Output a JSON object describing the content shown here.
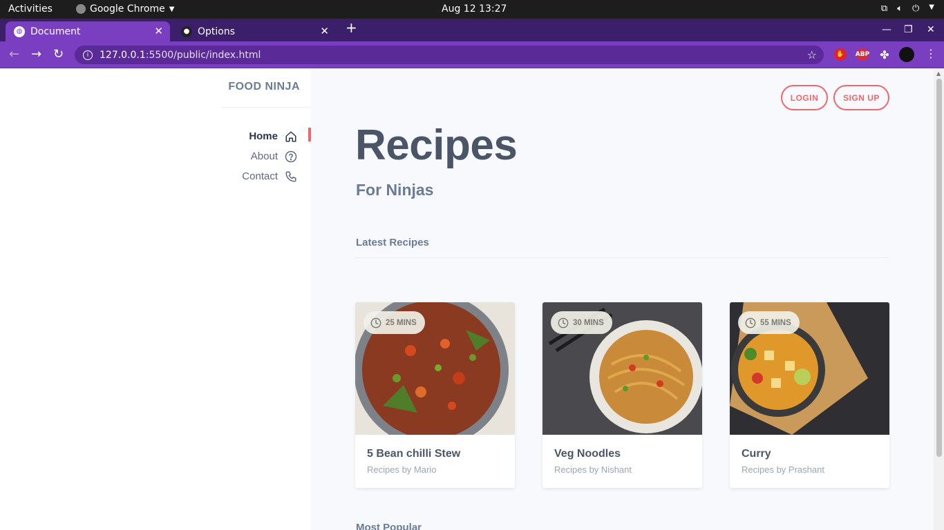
{
  "system_bar": {
    "activities": "Activities",
    "app_name": "Google Chrome",
    "clock": "Aug 12  13:27"
  },
  "browser": {
    "tabs": [
      {
        "title": "Document",
        "active": true
      },
      {
        "title": "Options",
        "active": false
      }
    ],
    "url_host": "127.0.0.1",
    "url_path": ":5500/public/index.html",
    "accent_color": "#7a3fc0"
  },
  "sidebar": {
    "brand": "FOOD NINJA",
    "nav": [
      {
        "label": "Home",
        "icon": "home-icon",
        "active": true
      },
      {
        "label": "About",
        "icon": "help-circle-icon",
        "active": false
      },
      {
        "label": "Contact",
        "icon": "phone-icon",
        "active": false
      }
    ],
    "indicator_color": "#f0666a"
  },
  "header": {
    "login": "LOGIN",
    "signup": "SIGN UP"
  },
  "main": {
    "title": "Recipes",
    "subtitle": "For Ninjas",
    "latest_heading": "Latest Recipes",
    "popular_heading": "Most Popular",
    "recipes": [
      {
        "time": "25 MINS",
        "name": "5 Bean chilli Stew",
        "author": "Recipes by Mario"
      },
      {
        "time": "30 MINS",
        "name": "Veg Noodles",
        "author": "Recipes by Nishant"
      },
      {
        "time": "55 MINS",
        "name": "Curry",
        "author": "Recipes by Prashant"
      }
    ]
  }
}
